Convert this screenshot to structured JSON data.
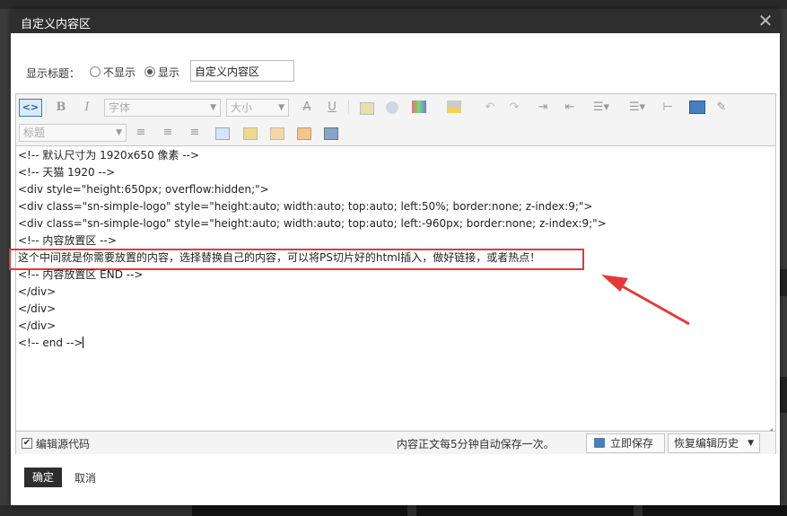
{
  "dialog": {
    "title": "自定义内容区",
    "close_symbol": "✕"
  },
  "title_row": {
    "label": "显示标题：",
    "option_hide": "不显示",
    "option_show": "显示",
    "selected": "显示",
    "input_value": "自定义内容区"
  },
  "toolbar": {
    "bold": "B",
    "italic": "I",
    "font_placeholder": "字体",
    "size_placeholder": "大小",
    "heading_placeholder": "标题",
    "strike": "A",
    "underline": "U",
    "source_symbol": "<>"
  },
  "code_lines": [
    "<!-- 默认尺寸为 1920x650 像素 -->",
    "<!-- 天猫 1920 -->",
    "<div style=\"height:650px; overflow:hidden;\">",
    "<div class=\"sn-simple-logo\" style=\"height:auto; width:auto; top:auto; left:50%; border:none; z-index:9;\">",
    "<div class=\"sn-simple-logo\" style=\"height:auto; width:auto; top:auto; left:-960px; border:none; z-index:9;\">",
    "<!-- 内容放置区 -->",
    "这个中间就是你需要放置的内容，选择替换自己的内容，可以将PS切片好的html插入，做好链接，或者热点！",
    "<!-- 内容放置区 END -->",
    "</div>",
    "</div>",
    "</div>",
    "<!-- end -->"
  ],
  "status": {
    "edit_source_label": "编辑源代码",
    "autosave_text": "内容正文每5分钟自动保存一次。",
    "save_now": "立即保存",
    "restore_history": "恢复编辑历史"
  },
  "footer": {
    "ok": "确定",
    "cancel": "取消"
  },
  "colors": {
    "highlight": "#e23a3a",
    "titlebar": "#2e2e2e"
  }
}
